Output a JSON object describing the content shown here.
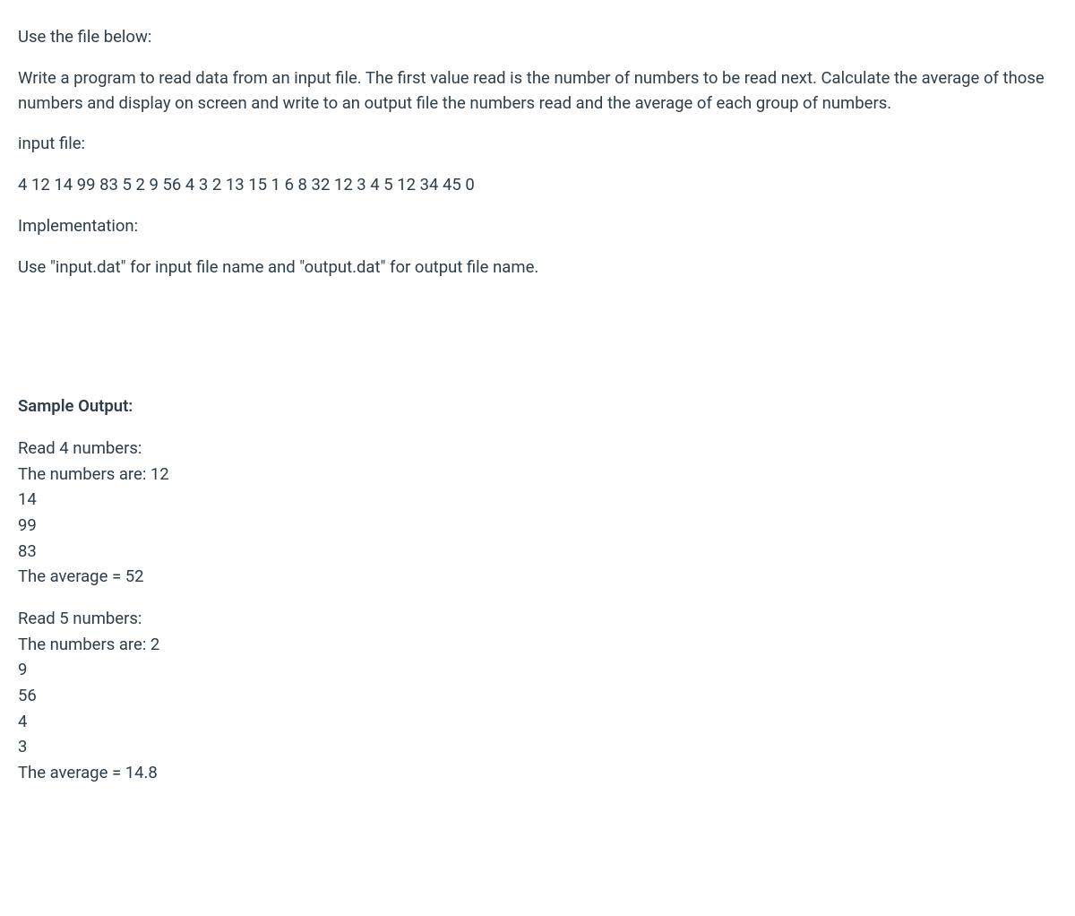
{
  "intro": "Use the file below:",
  "description": "Write a program to read data from an input file.  The first value read is the number of numbers to be read next.   Calculate the average of those numbers and display on screen and write to an output file the numbers read and the average of each group of numbers.",
  "inputFileLabel": " input file:",
  "inputFileContent": " 4  12 14  99  83  5  2  9  56  4  3  2  13  15  1  6  8   32  12   3  4  5  12  34  45  0",
  "implementationLabel": "Implementation:",
  "implementationText": "Use \"input.dat\" for input file name and \"output.dat\" for output file name.",
  "sampleOutputLabel": "Sample Output:",
  "groups": [
    {
      "readLine": "Read 4 numbers:",
      "numbersLine": "The numbers are: 12",
      "rest": [
        "14",
        "99",
        "83"
      ],
      "averageLine": "The average = 52"
    },
    {
      "readLine": "Read 5 numbers:",
      "numbersLine": "The numbers are: 2",
      "rest": [
        "9",
        "56",
        "4",
        "3"
      ],
      "averageLine": "The average = 14.8"
    }
  ]
}
